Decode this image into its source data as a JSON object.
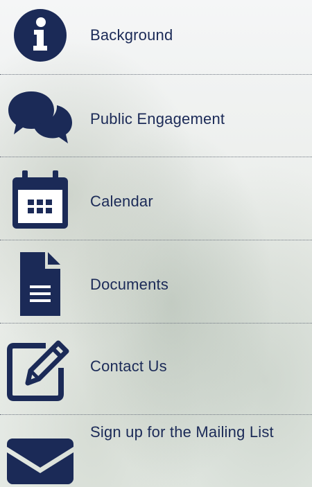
{
  "menu": {
    "items": [
      {
        "label": "Background",
        "icon": "info-circle-icon"
      },
      {
        "label": "Public Engagement",
        "icon": "speech-bubbles-icon"
      },
      {
        "label": "Calendar",
        "icon": "calendar-icon"
      },
      {
        "label": "Documents",
        "icon": "document-icon"
      },
      {
        "label": "Contact Us",
        "icon": "edit-icon"
      },
      {
        "label": "Sign up for the Mailing List",
        "icon": "envelope-icon"
      }
    ]
  },
  "colors": {
    "icon": "#1b2a57",
    "text": "#1b2a57",
    "divider": "#6d7480"
  }
}
